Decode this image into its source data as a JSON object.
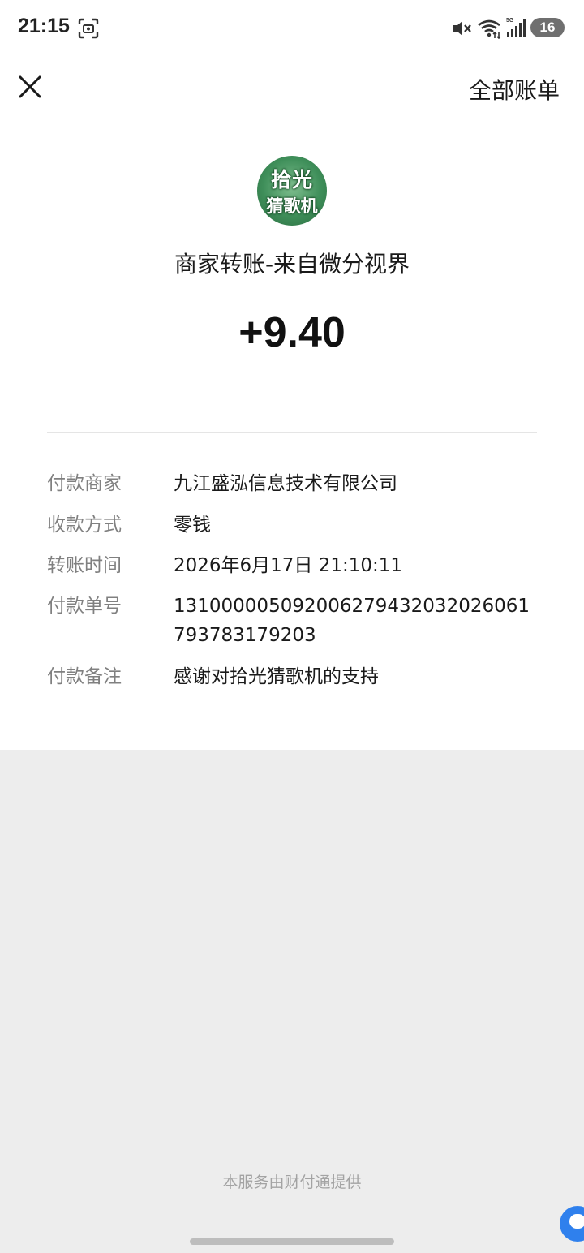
{
  "status_bar": {
    "time": "21:15",
    "battery": "16",
    "icons": [
      "screenshot-icon",
      "mute-icon",
      "wifi-icon",
      "signal-5g-icon"
    ]
  },
  "header": {
    "close_icon": "close-icon",
    "all_bills_label": "全部账单"
  },
  "merchant": {
    "avatar_line1": "拾光",
    "avatar_line2": "猜歌机",
    "title": "商家转账-来自微分视界",
    "amount": "+9.40"
  },
  "details": [
    {
      "label": "付款商家",
      "value": "九江盛泓信息技术有限公司"
    },
    {
      "label": "收款方式",
      "value": "零钱"
    },
    {
      "label": "转账时间",
      "value": "2026年6月17日 21:10:11"
    },
    {
      "label": "付款单号",
      "value": "131000005092006279432032026061793783179203"
    },
    {
      "label": "付款备注",
      "value": "感谢对拾光猜歌机的支持"
    }
  ],
  "footer": {
    "service_text": "本服务由财付通提供"
  },
  "colors": {
    "background": "#ededed",
    "card": "#ffffff",
    "label_gray": "#808080",
    "footer_gray": "#a3a3a3",
    "chat_blue": "#2f80ed"
  }
}
